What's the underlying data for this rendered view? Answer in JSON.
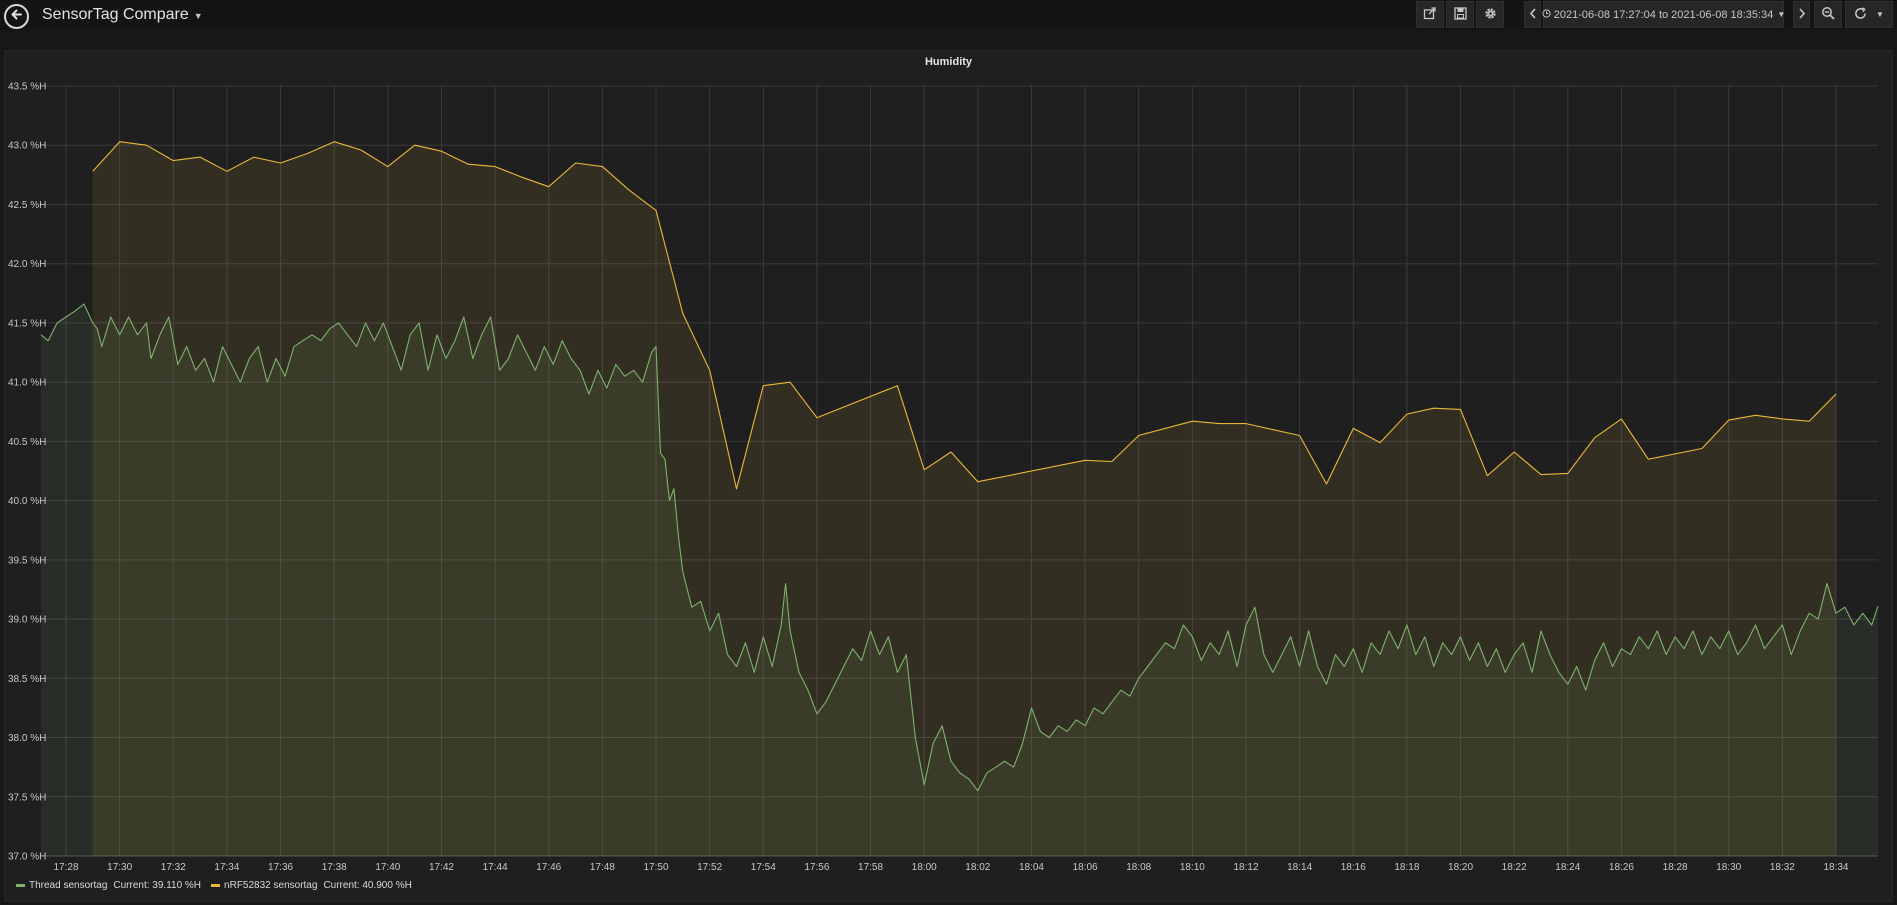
{
  "dashboard": {
    "title": "SensorTag Compare"
  },
  "toolbar": {
    "icons": [
      "share-icon",
      "save-icon",
      "gear-icon",
      "chevron-left-icon",
      "clock-icon",
      "caret-down-icon",
      "chevron-right-icon",
      "zoom-out-icon",
      "refresh-icon"
    ],
    "time_range": "2021-06-08 17:27:04 to 2021-06-08 18:35:34"
  },
  "colors": {
    "background": "#161719",
    "panel": "#1f1f20",
    "grid": "#3a3a3d",
    "thread": "#7eb26d",
    "nrf": "#eab839"
  },
  "chart_data": {
    "type": "area",
    "title": "Humidity",
    "xlabel": "",
    "ylabel": "",
    "grid": true,
    "legend_position": "bottom-left",
    "x_range": [
      "17:27:04",
      "18:35:34"
    ],
    "ylim": [
      37.0,
      43.5
    ],
    "y_ticks": [
      "37.0 %H",
      "37.5 %H",
      "38.0 %H",
      "38.5 %H",
      "39.0 %H",
      "39.5 %H",
      "40.0 %H",
      "40.5 %H",
      "41.0 %H",
      "41.5 %H",
      "42.0 %H",
      "42.5 %H",
      "43.0 %H",
      "43.5 %H"
    ],
    "x_ticks": [
      "17:28",
      "17:30",
      "17:32",
      "17:34",
      "17:36",
      "17:38",
      "17:40",
      "17:42",
      "17:44",
      "17:46",
      "17:48",
      "17:50",
      "17:52",
      "17:54",
      "17:56",
      "17:58",
      "18:00",
      "18:02",
      "18:04",
      "18:06",
      "18:08",
      "18:10",
      "18:12",
      "18:14",
      "18:16",
      "18:18",
      "18:20",
      "18:22",
      "18:24",
      "18:26",
      "18:28",
      "18:30",
      "18:32",
      "18:34"
    ],
    "series": [
      {
        "name": "Thread sensortag",
        "current": "Current: 39.110 %H",
        "color": "#7eb26d",
        "points": [
          [
            "17:27:04",
            41.4
          ],
          [
            "17:27:20",
            41.35
          ],
          [
            "17:27:40",
            41.5
          ],
          [
            "17:28:00",
            41.55
          ],
          [
            "17:28:20",
            41.6
          ],
          [
            "17:28:40",
            41.66
          ],
          [
            "17:29:00",
            41.5
          ],
          [
            "17:29:10",
            41.45
          ],
          [
            "17:29:20",
            41.3
          ],
          [
            "17:29:40",
            41.55
          ],
          [
            "17:30:00",
            41.4
          ],
          [
            "17:30:20",
            41.55
          ],
          [
            "17:30:40",
            41.4
          ],
          [
            "17:31:00",
            41.5
          ],
          [
            "17:31:10",
            41.2
          ],
          [
            "17:31:30",
            41.4
          ],
          [
            "17:31:50",
            41.55
          ],
          [
            "17:32:10",
            41.15
          ],
          [
            "17:32:30",
            41.3
          ],
          [
            "17:32:50",
            41.1
          ],
          [
            "17:33:10",
            41.2
          ],
          [
            "17:33:30",
            41.0
          ],
          [
            "17:33:50",
            41.3
          ],
          [
            "17:34:10",
            41.15
          ],
          [
            "17:34:30",
            41.0
          ],
          [
            "17:34:50",
            41.2
          ],
          [
            "17:35:10",
            41.3
          ],
          [
            "17:35:30",
            41.0
          ],
          [
            "17:35:50",
            41.2
          ],
          [
            "17:36:10",
            41.05
          ],
          [
            "17:36:30",
            41.3
          ],
          [
            "17:36:50",
            41.35
          ],
          [
            "17:37:10",
            41.4
          ],
          [
            "17:37:30",
            41.35
          ],
          [
            "17:37:50",
            41.45
          ],
          [
            "17:38:10",
            41.5
          ],
          [
            "17:38:30",
            41.4
          ],
          [
            "17:38:50",
            41.3
          ],
          [
            "17:39:10",
            41.5
          ],
          [
            "17:39:30",
            41.35
          ],
          [
            "17:39:50",
            41.5
          ],
          [
            "17:40:10",
            41.3
          ],
          [
            "17:40:30",
            41.1
          ],
          [
            "17:40:50",
            41.4
          ],
          [
            "17:41:10",
            41.5
          ],
          [
            "17:41:30",
            41.1
          ],
          [
            "17:41:50",
            41.4
          ],
          [
            "17:42:10",
            41.2
          ],
          [
            "17:42:30",
            41.35
          ],
          [
            "17:42:50",
            41.55
          ],
          [
            "17:43:10",
            41.2
          ],
          [
            "17:43:30",
            41.4
          ],
          [
            "17:43:50",
            41.55
          ],
          [
            "17:44:10",
            41.1
          ],
          [
            "17:44:30",
            41.2
          ],
          [
            "17:44:50",
            41.4
          ],
          [
            "17:45:10",
            41.25
          ],
          [
            "17:45:30",
            41.1
          ],
          [
            "17:45:50",
            41.3
          ],
          [
            "17:46:10",
            41.15
          ],
          [
            "17:46:30",
            41.35
          ],
          [
            "17:46:50",
            41.2
          ],
          [
            "17:47:10",
            41.1
          ],
          [
            "17:47:30",
            40.9
          ],
          [
            "17:47:50",
            41.1
          ],
          [
            "17:48:10",
            40.95
          ],
          [
            "17:48:30",
            41.15
          ],
          [
            "17:48:50",
            41.05
          ],
          [
            "17:49:10",
            41.1
          ],
          [
            "17:49:30",
            41.0
          ],
          [
            "17:49:50",
            41.25
          ],
          [
            "17:50:00",
            41.3
          ],
          [
            "17:50:10",
            40.4
          ],
          [
            "17:50:20",
            40.35
          ],
          [
            "17:50:30",
            40.0
          ],
          [
            "17:50:40",
            40.1
          ],
          [
            "17:50:50",
            39.7
          ],
          [
            "17:51:00",
            39.4
          ],
          [
            "17:51:20",
            39.1
          ],
          [
            "17:51:40",
            39.15
          ],
          [
            "17:52:00",
            38.9
          ],
          [
            "17:52:20",
            39.05
          ],
          [
            "17:52:40",
            38.7
          ],
          [
            "17:53:00",
            38.6
          ],
          [
            "17:53:20",
            38.8
          ],
          [
            "17:53:40",
            38.55
          ],
          [
            "17:54:00",
            38.85
          ],
          [
            "17:54:20",
            38.6
          ],
          [
            "17:54:40",
            38.95
          ],
          [
            "17:54:50",
            39.3
          ],
          [
            "17:55:00",
            38.9
          ],
          [
            "17:55:20",
            38.55
          ],
          [
            "17:55:40",
            38.4
          ],
          [
            "17:56:00",
            38.2
          ],
          [
            "17:56:20",
            38.3
          ],
          [
            "17:56:40",
            38.45
          ],
          [
            "17:57:00",
            38.6
          ],
          [
            "17:57:20",
            38.75
          ],
          [
            "17:57:40",
            38.65
          ],
          [
            "17:58:00",
            38.9
          ],
          [
            "17:58:20",
            38.7
          ],
          [
            "17:58:40",
            38.85
          ],
          [
            "17:59:00",
            38.55
          ],
          [
            "17:59:20",
            38.7
          ],
          [
            "17:59:40",
            38.0
          ],
          [
            "18:00:00",
            37.6
          ],
          [
            "18:00:20",
            37.95
          ],
          [
            "18:00:40",
            38.1
          ],
          [
            "18:01:00",
            37.8
          ],
          [
            "18:01:20",
            37.7
          ],
          [
            "18:01:40",
            37.65
          ],
          [
            "18:02:00",
            37.55
          ],
          [
            "18:02:20",
            37.7
          ],
          [
            "18:02:40",
            37.75
          ],
          [
            "18:03:00",
            37.8
          ],
          [
            "18:03:20",
            37.75
          ],
          [
            "18:03:40",
            37.95
          ],
          [
            "18:04:00",
            38.25
          ],
          [
            "18:04:20",
            38.05
          ],
          [
            "18:04:40",
            38.0
          ],
          [
            "18:05:00",
            38.1
          ],
          [
            "18:05:20",
            38.05
          ],
          [
            "18:05:40",
            38.15
          ],
          [
            "18:06:00",
            38.1
          ],
          [
            "18:06:20",
            38.25
          ],
          [
            "18:06:40",
            38.2
          ],
          [
            "18:07:00",
            38.3
          ],
          [
            "18:07:20",
            38.4
          ],
          [
            "18:07:40",
            38.35
          ],
          [
            "18:08:00",
            38.5
          ],
          [
            "18:08:20",
            38.6
          ],
          [
            "18:08:40",
            38.7
          ],
          [
            "18:09:00",
            38.8
          ],
          [
            "18:09:20",
            38.75
          ],
          [
            "18:09:40",
            38.95
          ],
          [
            "18:10:00",
            38.85
          ],
          [
            "18:10:20",
            38.65
          ],
          [
            "18:10:40",
            38.8
          ],
          [
            "18:11:00",
            38.7
          ],
          [
            "18:11:20",
            38.9
          ],
          [
            "18:11:40",
            38.6
          ],
          [
            "18:12:00",
            38.95
          ],
          [
            "18:12:20",
            39.1
          ],
          [
            "18:12:40",
            38.7
          ],
          [
            "18:13:00",
            38.55
          ],
          [
            "18:13:20",
            38.7
          ],
          [
            "18:13:40",
            38.85
          ],
          [
            "18:14:00",
            38.6
          ],
          [
            "18:14:20",
            38.9
          ],
          [
            "18:14:40",
            38.6
          ],
          [
            "18:15:00",
            38.45
          ],
          [
            "18:15:20",
            38.7
          ],
          [
            "18:15:40",
            38.6
          ],
          [
            "18:16:00",
            38.75
          ],
          [
            "18:16:20",
            38.55
          ],
          [
            "18:16:40",
            38.8
          ],
          [
            "18:17:00",
            38.7
          ],
          [
            "18:17:20",
            38.9
          ],
          [
            "18:17:40",
            38.75
          ],
          [
            "18:18:00",
            38.95
          ],
          [
            "18:18:20",
            38.7
          ],
          [
            "18:18:40",
            38.85
          ],
          [
            "18:19:00",
            38.6
          ],
          [
            "18:19:20",
            38.8
          ],
          [
            "18:19:40",
            38.7
          ],
          [
            "18:20:00",
            38.85
          ],
          [
            "18:20:20",
            38.65
          ],
          [
            "18:20:40",
            38.8
          ],
          [
            "18:21:00",
            38.6
          ],
          [
            "18:21:20",
            38.75
          ],
          [
            "18:21:40",
            38.55
          ],
          [
            "18:22:00",
            38.7
          ],
          [
            "18:22:20",
            38.8
          ],
          [
            "18:22:40",
            38.55
          ],
          [
            "18:23:00",
            38.9
          ],
          [
            "18:23:20",
            38.7
          ],
          [
            "18:23:40",
            38.55
          ],
          [
            "18:24:00",
            38.45
          ],
          [
            "18:24:20",
            38.6
          ],
          [
            "18:24:40",
            38.4
          ],
          [
            "18:25:00",
            38.65
          ],
          [
            "18:25:20",
            38.8
          ],
          [
            "18:25:40",
            38.6
          ],
          [
            "18:26:00",
            38.75
          ],
          [
            "18:26:20",
            38.7
          ],
          [
            "18:26:40",
            38.85
          ],
          [
            "18:27:00",
            38.75
          ],
          [
            "18:27:20",
            38.9
          ],
          [
            "18:27:40",
            38.7
          ],
          [
            "18:28:00",
            38.85
          ],
          [
            "18:28:20",
            38.75
          ],
          [
            "18:28:40",
            38.9
          ],
          [
            "18:29:00",
            38.7
          ],
          [
            "18:29:20",
            38.85
          ],
          [
            "18:29:40",
            38.75
          ],
          [
            "18:30:00",
            38.9
          ],
          [
            "18:30:20",
            38.7
          ],
          [
            "18:30:40",
            38.8
          ],
          [
            "18:31:00",
            38.95
          ],
          [
            "18:31:20",
            38.75
          ],
          [
            "18:31:40",
            38.85
          ],
          [
            "18:32:00",
            38.95
          ],
          [
            "18:32:20",
            38.7
          ],
          [
            "18:32:40",
            38.9
          ],
          [
            "18:33:00",
            39.05
          ],
          [
            "18:33:20",
            39.0
          ],
          [
            "18:33:40",
            39.3
          ],
          [
            "18:34:00",
            39.05
          ],
          [
            "18:34:20",
            39.1
          ],
          [
            "18:34:40",
            38.95
          ],
          [
            "18:35:00",
            39.05
          ],
          [
            "18:35:20",
            38.95
          ],
          [
            "18:35:34",
            39.11
          ]
        ]
      },
      {
        "name": "nRF52832 sensortag",
        "current": "Current: 40.900 %H",
        "color": "#eab839",
        "points": [
          [
            "17:29:00",
            42.78
          ],
          [
            "17:30:00",
            43.03
          ],
          [
            "17:31:00",
            43.0
          ],
          [
            "17:32:00",
            42.87
          ],
          [
            "17:33:00",
            42.9
          ],
          [
            "17:34:00",
            42.78
          ],
          [
            "17:35:00",
            42.9
          ],
          [
            "17:36:00",
            42.85
          ],
          [
            "17:37:00",
            42.93
          ],
          [
            "17:38:00",
            43.03
          ],
          [
            "17:39:00",
            42.96
          ],
          [
            "17:40:00",
            42.82
          ],
          [
            "17:41:00",
            43.0
          ],
          [
            "17:42:00",
            42.95
          ],
          [
            "17:43:00",
            42.84
          ],
          [
            "17:44:00",
            42.82
          ],
          [
            "17:45:00",
            42.73
          ],
          [
            "17:46:00",
            42.65
          ],
          [
            "17:47:00",
            42.85
          ],
          [
            "17:48:00",
            42.82
          ],
          [
            "17:49:00",
            42.62
          ],
          [
            "17:50:00",
            42.45
          ],
          [
            "17:51:00",
            41.58
          ],
          [
            "17:52:00",
            41.1
          ],
          [
            "17:53:00",
            40.1
          ],
          [
            "17:54:00",
            40.97
          ],
          [
            "17:55:00",
            41.0
          ],
          [
            "17:56:00",
            40.7
          ],
          [
            "17:59:00",
            40.97
          ],
          [
            "18:00:00",
            40.26
          ],
          [
            "18:01:00",
            40.41
          ],
          [
            "18:02:00",
            40.16
          ],
          [
            "18:06:00",
            40.34
          ],
          [
            "18:07:00",
            40.33
          ],
          [
            "18:08:00",
            40.55
          ],
          [
            "18:10:00",
            40.67
          ],
          [
            "18:11:00",
            40.65
          ],
          [
            "18:12:00",
            40.65
          ],
          [
            "18:14:00",
            40.55
          ],
          [
            "18:15:00",
            40.14
          ],
          [
            "18:16:00",
            40.61
          ],
          [
            "18:17:00",
            40.49
          ],
          [
            "18:18:00",
            40.73
          ],
          [
            "18:19:00",
            40.78
          ],
          [
            "18:20:00",
            40.77
          ],
          [
            "18:21:00",
            40.21
          ],
          [
            "18:22:00",
            40.41
          ],
          [
            "18:23:00",
            40.22
          ],
          [
            "18:24:00",
            40.23
          ],
          [
            "18:25:00",
            40.53
          ],
          [
            "18:26:00",
            40.69
          ],
          [
            "18:27:00",
            40.35
          ],
          [
            "18:29:00",
            40.44
          ],
          [
            "18:30:00",
            40.68
          ],
          [
            "18:31:00",
            40.72
          ],
          [
            "18:32:00",
            40.69
          ],
          [
            "18:33:00",
            40.67
          ],
          [
            "18:34:00",
            40.9
          ]
        ]
      }
    ]
  }
}
